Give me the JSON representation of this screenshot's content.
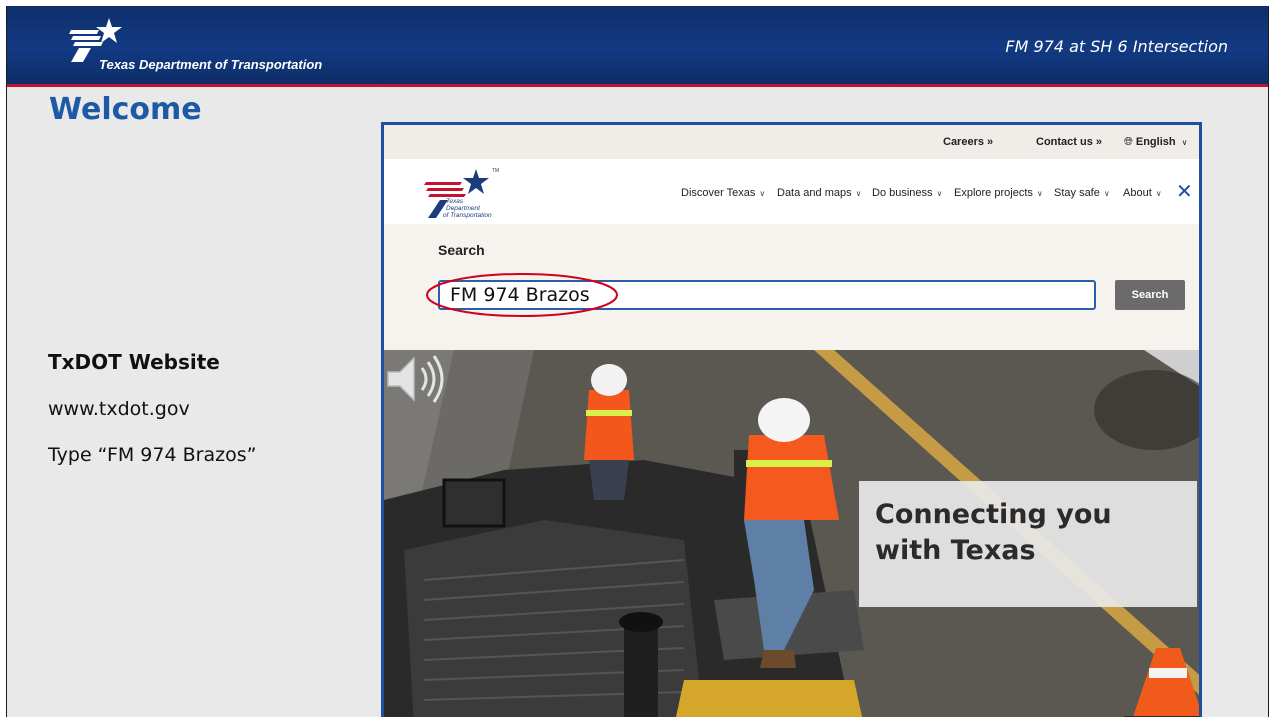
{
  "banner": {
    "agency": "Texas Department of Transportation",
    "deck_title": "FM 974 at SH 6 Intersection"
  },
  "slide": {
    "heading": "Welcome",
    "left_heading": "TxDOT Website",
    "left_url": "www.txdot.gov",
    "left_instruction": "Type “FM 974 Brazos”"
  },
  "site": {
    "utility_links": [
      "Careers »",
      "Contact us »",
      "English"
    ],
    "logo_lines": [
      "Texas",
      "Department",
      "of Transportation"
    ],
    "logo_mark": "TM",
    "nav_items": [
      "Discover Texas",
      "Data and maps",
      "Do business",
      "Explore projects",
      "Stay safe",
      "About"
    ],
    "search": {
      "label": "Search",
      "value": "FM 974 Brazos",
      "button": "Search"
    },
    "hero_tagline": "Connecting you with Texas"
  },
  "icons": {
    "globe": "globe-icon",
    "chevron": "chevron-down-icon",
    "close": "close-icon",
    "audio": "speaker-icon"
  },
  "colors": {
    "banner_navy": "#123a83",
    "banner_red_rule": "#c41230",
    "heading_blue": "#1d5aa5",
    "frame_blue": "#1f4fa0",
    "ellipse_red": "#d0021b"
  }
}
